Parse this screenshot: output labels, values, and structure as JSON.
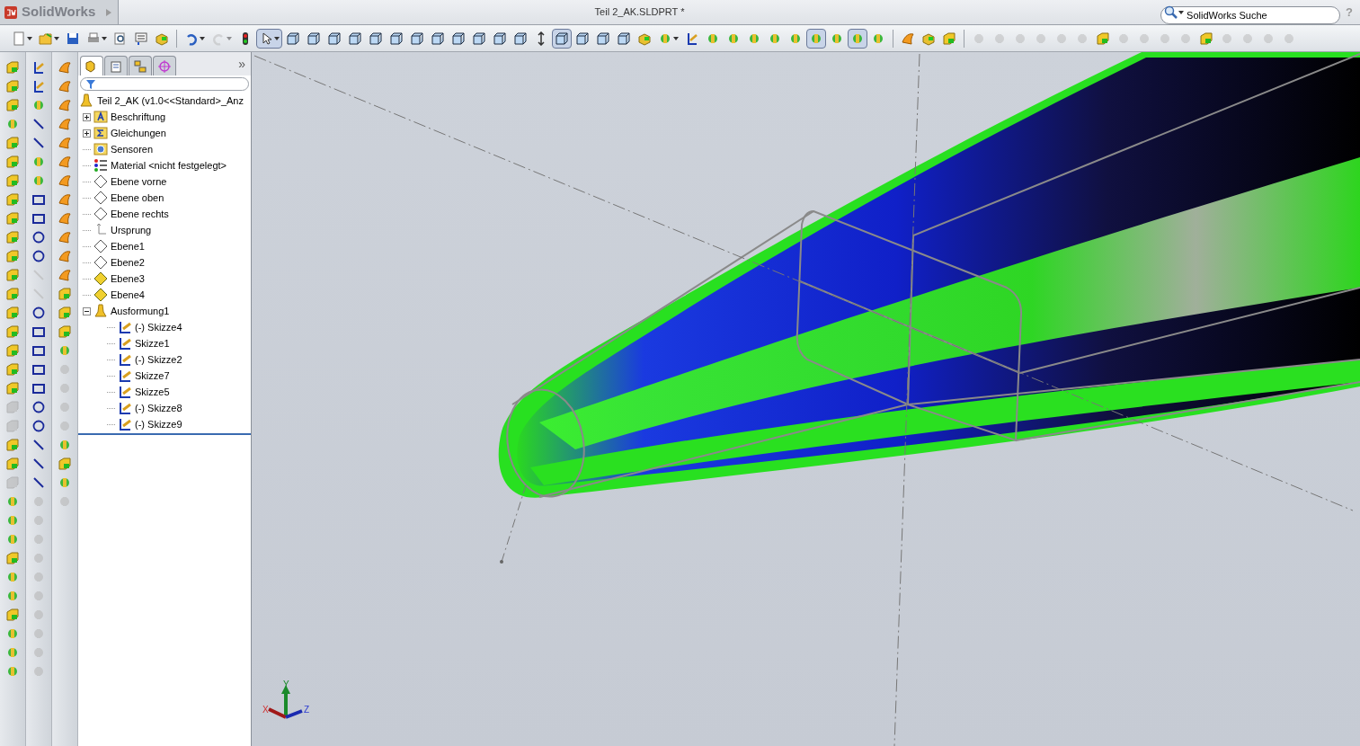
{
  "app": {
    "logo": "SolidWorks",
    "title": "Teil 2_AK.SLDPRT *",
    "search": {
      "placeholder": "SolidWorks Suche"
    },
    "help_glyph": "?"
  },
  "toolbar": [
    {
      "kind": "page",
      "caret": true,
      "pressed": false,
      "disabled": false
    },
    {
      "kind": "folder",
      "caret": true,
      "pressed": false,
      "disabled": false
    },
    {
      "kind": "save",
      "caret": false,
      "pressed": false,
      "disabled": false
    },
    {
      "kind": "printer",
      "caret": true,
      "pressed": false,
      "disabled": false
    },
    {
      "kind": "magnifier",
      "caret": false,
      "pressed": false,
      "disabled": false
    },
    {
      "kind": "form",
      "caret": false,
      "pressed": false,
      "disabled": false
    },
    {
      "kind": "box",
      "caret": false,
      "pressed": false,
      "disabled": false
    },
    {
      "kind": "sep"
    },
    {
      "kind": "undo",
      "caret": true,
      "pressed": false,
      "disabled": false
    },
    {
      "kind": "redo",
      "caret": true,
      "pressed": false,
      "disabled": true
    },
    {
      "kind": "light",
      "caret": false,
      "pressed": false,
      "disabled": false
    },
    {
      "kind": "pointer",
      "caret": true,
      "pressed": true,
      "disabled": false
    },
    {
      "kind": "cube",
      "caret": false,
      "pressed": false,
      "disabled": false
    },
    {
      "kind": "cube",
      "caret": false,
      "pressed": false,
      "disabled": false
    },
    {
      "kind": "cube",
      "caret": false,
      "pressed": false,
      "disabled": false
    },
    {
      "kind": "cube",
      "caret": false,
      "pressed": false,
      "disabled": false
    },
    {
      "kind": "cube",
      "caret": false,
      "pressed": false,
      "disabled": false
    },
    {
      "kind": "cube",
      "caret": false,
      "pressed": false,
      "disabled": false
    },
    {
      "kind": "cube",
      "caret": false,
      "pressed": false,
      "disabled": false
    },
    {
      "kind": "cube",
      "caret": false,
      "pressed": false,
      "disabled": false
    },
    {
      "kind": "cube",
      "caret": false,
      "pressed": false,
      "disabled": false
    },
    {
      "kind": "cube",
      "caret": false,
      "pressed": false,
      "disabled": false
    },
    {
      "kind": "cube",
      "caret": false,
      "pressed": false,
      "disabled": false
    },
    {
      "kind": "cube",
      "caret": false,
      "pressed": false,
      "disabled": false
    },
    {
      "kind": "arrow",
      "caret": false,
      "pressed": false,
      "disabled": false
    },
    {
      "kind": "cube",
      "caret": false,
      "pressed": true,
      "disabled": false
    },
    {
      "kind": "cube",
      "caret": false,
      "pressed": false,
      "disabled": false
    },
    {
      "kind": "cube",
      "caret": false,
      "pressed": false,
      "disabled": false
    },
    {
      "kind": "cube",
      "caret": false,
      "pressed": false,
      "disabled": false
    },
    {
      "kind": "box",
      "caret": false,
      "pressed": false,
      "disabled": false
    },
    {
      "kind": "tool",
      "caret": true,
      "pressed": false,
      "disabled": false
    },
    {
      "kind": "sketch",
      "caret": false,
      "pressed": false,
      "disabled": false
    },
    {
      "kind": "tool",
      "caret": false,
      "pressed": false,
      "disabled": false
    },
    {
      "kind": "tool",
      "caret": false,
      "pressed": false,
      "disabled": false
    },
    {
      "kind": "tool",
      "caret": false,
      "pressed": false,
      "disabled": false
    },
    {
      "kind": "tool",
      "caret": false,
      "pressed": false,
      "disabled": false
    },
    {
      "kind": "tool",
      "caret": false,
      "pressed": false,
      "disabled": false
    },
    {
      "kind": "tool",
      "caret": false,
      "pressed": true,
      "disabled": false
    },
    {
      "kind": "tool",
      "caret": false,
      "pressed": false,
      "disabled": false
    },
    {
      "kind": "tool",
      "caret": false,
      "pressed": true,
      "disabled": false
    },
    {
      "kind": "tool",
      "caret": false,
      "pressed": false,
      "disabled": false
    },
    {
      "kind": "sep"
    },
    {
      "kind": "surface",
      "caret": false,
      "pressed": false,
      "disabled": false
    },
    {
      "kind": "box",
      "caret": false,
      "pressed": false,
      "disabled": false
    },
    {
      "kind": "solid",
      "caret": false,
      "pressed": false,
      "disabled": false
    },
    {
      "kind": "sep"
    },
    {
      "kind": "tool",
      "caret": false,
      "pressed": false,
      "disabled": true
    },
    {
      "kind": "tool",
      "caret": false,
      "pressed": false,
      "disabled": true
    },
    {
      "kind": "tool",
      "caret": false,
      "pressed": false,
      "disabled": true
    },
    {
      "kind": "tool",
      "caret": false,
      "pressed": false,
      "disabled": true
    },
    {
      "kind": "tool",
      "caret": false,
      "pressed": false,
      "disabled": true
    },
    {
      "kind": "tool",
      "caret": false,
      "pressed": false,
      "disabled": true
    },
    {
      "kind": "solid",
      "caret": false,
      "pressed": false,
      "disabled": false
    },
    {
      "kind": "tool",
      "caret": false,
      "pressed": false,
      "disabled": true
    },
    {
      "kind": "tool",
      "caret": false,
      "pressed": false,
      "disabled": true
    },
    {
      "kind": "tool",
      "caret": false,
      "pressed": false,
      "disabled": true
    },
    {
      "kind": "tool",
      "caret": false,
      "pressed": false,
      "disabled": true
    },
    {
      "kind": "solid",
      "caret": false,
      "pressed": false,
      "disabled": false
    },
    {
      "kind": "tool",
      "caret": false,
      "pressed": false,
      "disabled": true
    },
    {
      "kind": "tool",
      "caret": false,
      "pressed": false,
      "disabled": true
    },
    {
      "kind": "tool",
      "caret": false,
      "pressed": false,
      "disabled": true
    },
    {
      "kind": "tool",
      "caret": false,
      "pressed": false,
      "disabled": true
    }
  ],
  "tool_columns": [
    [
      {
        "kind": "solid",
        "disabled": false
      },
      {
        "kind": "solid",
        "disabled": false
      },
      {
        "kind": "solid",
        "disabled": false
      },
      {
        "kind": "tool",
        "disabled": false
      },
      {
        "kind": "solid",
        "disabled": false
      },
      {
        "kind": "solid",
        "disabled": false
      },
      {
        "kind": "solid",
        "disabled": false
      },
      {
        "kind": "solid",
        "disabled": false
      },
      {
        "kind": "solid",
        "disabled": false
      },
      {
        "kind": "solid",
        "disabled": false
      },
      {
        "kind": "solid",
        "disabled": false
      },
      {
        "kind": "solid",
        "disabled": false
      },
      {
        "kind": "solid",
        "disabled": false
      },
      {
        "kind": "solid",
        "disabled": false
      },
      {
        "kind": "solid",
        "disabled": false
      },
      {
        "kind": "solid",
        "disabled": false
      },
      {
        "kind": "solid",
        "disabled": false
      },
      {
        "kind": "solid",
        "disabled": false
      },
      {
        "kind": "solid",
        "disabled": true
      },
      {
        "kind": "solid",
        "disabled": true
      },
      {
        "kind": "solid",
        "disabled": false
      },
      {
        "kind": "solid",
        "disabled": false
      },
      {
        "kind": "solid",
        "disabled": true
      },
      {
        "kind": "tool",
        "disabled": false
      },
      {
        "kind": "tool",
        "disabled": false
      },
      {
        "kind": "tool",
        "disabled": false
      },
      {
        "kind": "solid",
        "disabled": false
      },
      {
        "kind": "tool",
        "disabled": false
      },
      {
        "kind": "tool",
        "disabled": false
      },
      {
        "kind": "solid",
        "disabled": false
      },
      {
        "kind": "tool",
        "disabled": false
      },
      {
        "kind": "tool",
        "disabled": false
      },
      {
        "kind": "tool",
        "disabled": false
      }
    ],
    [
      {
        "kind": "sketch",
        "disabled": false
      },
      {
        "kind": "sketch",
        "disabled": false
      },
      {
        "kind": "tool",
        "disabled": false
      },
      {
        "kind": "line",
        "disabled": false
      },
      {
        "kind": "line",
        "disabled": false
      },
      {
        "kind": "tool",
        "disabled": false
      },
      {
        "kind": "tool",
        "disabled": false
      },
      {
        "kind": "rect",
        "disabled": false
      },
      {
        "kind": "rect",
        "disabled": false
      },
      {
        "kind": "circle",
        "disabled": false
      },
      {
        "kind": "circle",
        "disabled": false
      },
      {
        "kind": "line",
        "disabled": true
      },
      {
        "kind": "line",
        "disabled": true
      },
      {
        "kind": "circle",
        "disabled": false
      },
      {
        "kind": "rect",
        "disabled": false
      },
      {
        "kind": "rect",
        "disabled": false
      },
      {
        "kind": "rect",
        "disabled": false
      },
      {
        "kind": "rect",
        "disabled": false
      },
      {
        "kind": "circle",
        "disabled": false
      },
      {
        "kind": "circle",
        "disabled": false
      },
      {
        "kind": "line",
        "disabled": false
      },
      {
        "kind": "line",
        "disabled": false
      },
      {
        "kind": "line",
        "disabled": false
      },
      {
        "kind": "tool",
        "disabled": true
      },
      {
        "kind": "tool",
        "disabled": true
      },
      {
        "kind": "tool",
        "disabled": true
      },
      {
        "kind": "tool",
        "disabled": true
      },
      {
        "kind": "tool",
        "disabled": true
      },
      {
        "kind": "tool",
        "disabled": true
      },
      {
        "kind": "tool",
        "disabled": true
      },
      {
        "kind": "tool",
        "disabled": true
      },
      {
        "kind": "tool",
        "disabled": true
      },
      {
        "kind": "tool",
        "disabled": true
      }
    ],
    [
      {
        "kind": "surface",
        "disabled": false
      },
      {
        "kind": "surface",
        "disabled": false
      },
      {
        "kind": "surface",
        "disabled": false
      },
      {
        "kind": "surface",
        "disabled": false
      },
      {
        "kind": "surface",
        "disabled": false
      },
      {
        "kind": "surface",
        "disabled": false
      },
      {
        "kind": "surface",
        "disabled": false
      },
      {
        "kind": "surface",
        "disabled": false
      },
      {
        "kind": "surface",
        "disabled": false
      },
      {
        "kind": "surface",
        "disabled": false
      },
      {
        "kind": "surface",
        "disabled": false
      },
      {
        "kind": "surface",
        "disabled": false
      },
      {
        "kind": "solid",
        "disabled": false
      },
      {
        "kind": "solid",
        "disabled": false
      },
      {
        "kind": "solid",
        "disabled": false
      },
      {
        "kind": "tool",
        "disabled": false
      },
      {
        "kind": "tool",
        "disabled": true
      },
      {
        "kind": "tool",
        "disabled": true
      },
      {
        "kind": "tool",
        "disabled": true
      },
      {
        "kind": "tool",
        "disabled": true
      },
      {
        "kind": "tool",
        "disabled": false
      },
      {
        "kind": "solid",
        "disabled": false
      },
      {
        "kind": "tool",
        "disabled": false
      },
      {
        "kind": "tool",
        "disabled": true
      }
    ]
  ],
  "panel_tabs": [
    {
      "kind": "feature",
      "selected": true
    },
    {
      "kind": "property",
      "selected": false
    },
    {
      "kind": "config",
      "selected": false
    },
    {
      "kind": "display",
      "selected": false
    }
  ],
  "panel_collapse": "»",
  "tree": {
    "root": "Teil 2_AK  (v1.0<<Standard>_Anz",
    "items": [
      {
        "label": "Beschriftung",
        "kind": "annotation",
        "expanded": false
      },
      {
        "label": "Gleichungen",
        "kind": "equation",
        "expanded": false
      },
      {
        "label": "Sensoren",
        "kind": "sensor"
      },
      {
        "label": "Material <nicht festgelegt>",
        "kind": "material"
      },
      {
        "label": "Ebene vorne",
        "kind": "plane",
        "shown": false
      },
      {
        "label": "Ebene oben",
        "kind": "plane",
        "shown": false
      },
      {
        "label": "Ebene rechts",
        "kind": "plane",
        "shown": false
      },
      {
        "label": "Ursprung",
        "kind": "origin"
      },
      {
        "label": "Ebene1",
        "kind": "plane",
        "shown": false
      },
      {
        "label": "Ebene2",
        "kind": "plane",
        "shown": false
      },
      {
        "label": "Ebene3",
        "kind": "plane",
        "shown": true
      },
      {
        "label": "Ebene4",
        "kind": "plane",
        "shown": true
      },
      {
        "label": "Ausformung1",
        "kind": "loft",
        "expanded": true,
        "children": [
          {
            "label": "(-) Skizze4",
            "kind": "sketch"
          },
          {
            "label": "Skizze1",
            "kind": "sketch"
          },
          {
            "label": "(-) Skizze2",
            "kind": "sketch"
          },
          {
            "label": "Skizze7",
            "kind": "sketch"
          },
          {
            "label": "Skizze5",
            "kind": "sketch"
          },
          {
            "label": "(-) Skizze8",
            "kind": "sketch"
          },
          {
            "label": "(-) Skizze9",
            "kind": "sketch"
          }
        ]
      }
    ]
  },
  "triad": {
    "x": "X",
    "y": "Y",
    "z": "Z"
  }
}
